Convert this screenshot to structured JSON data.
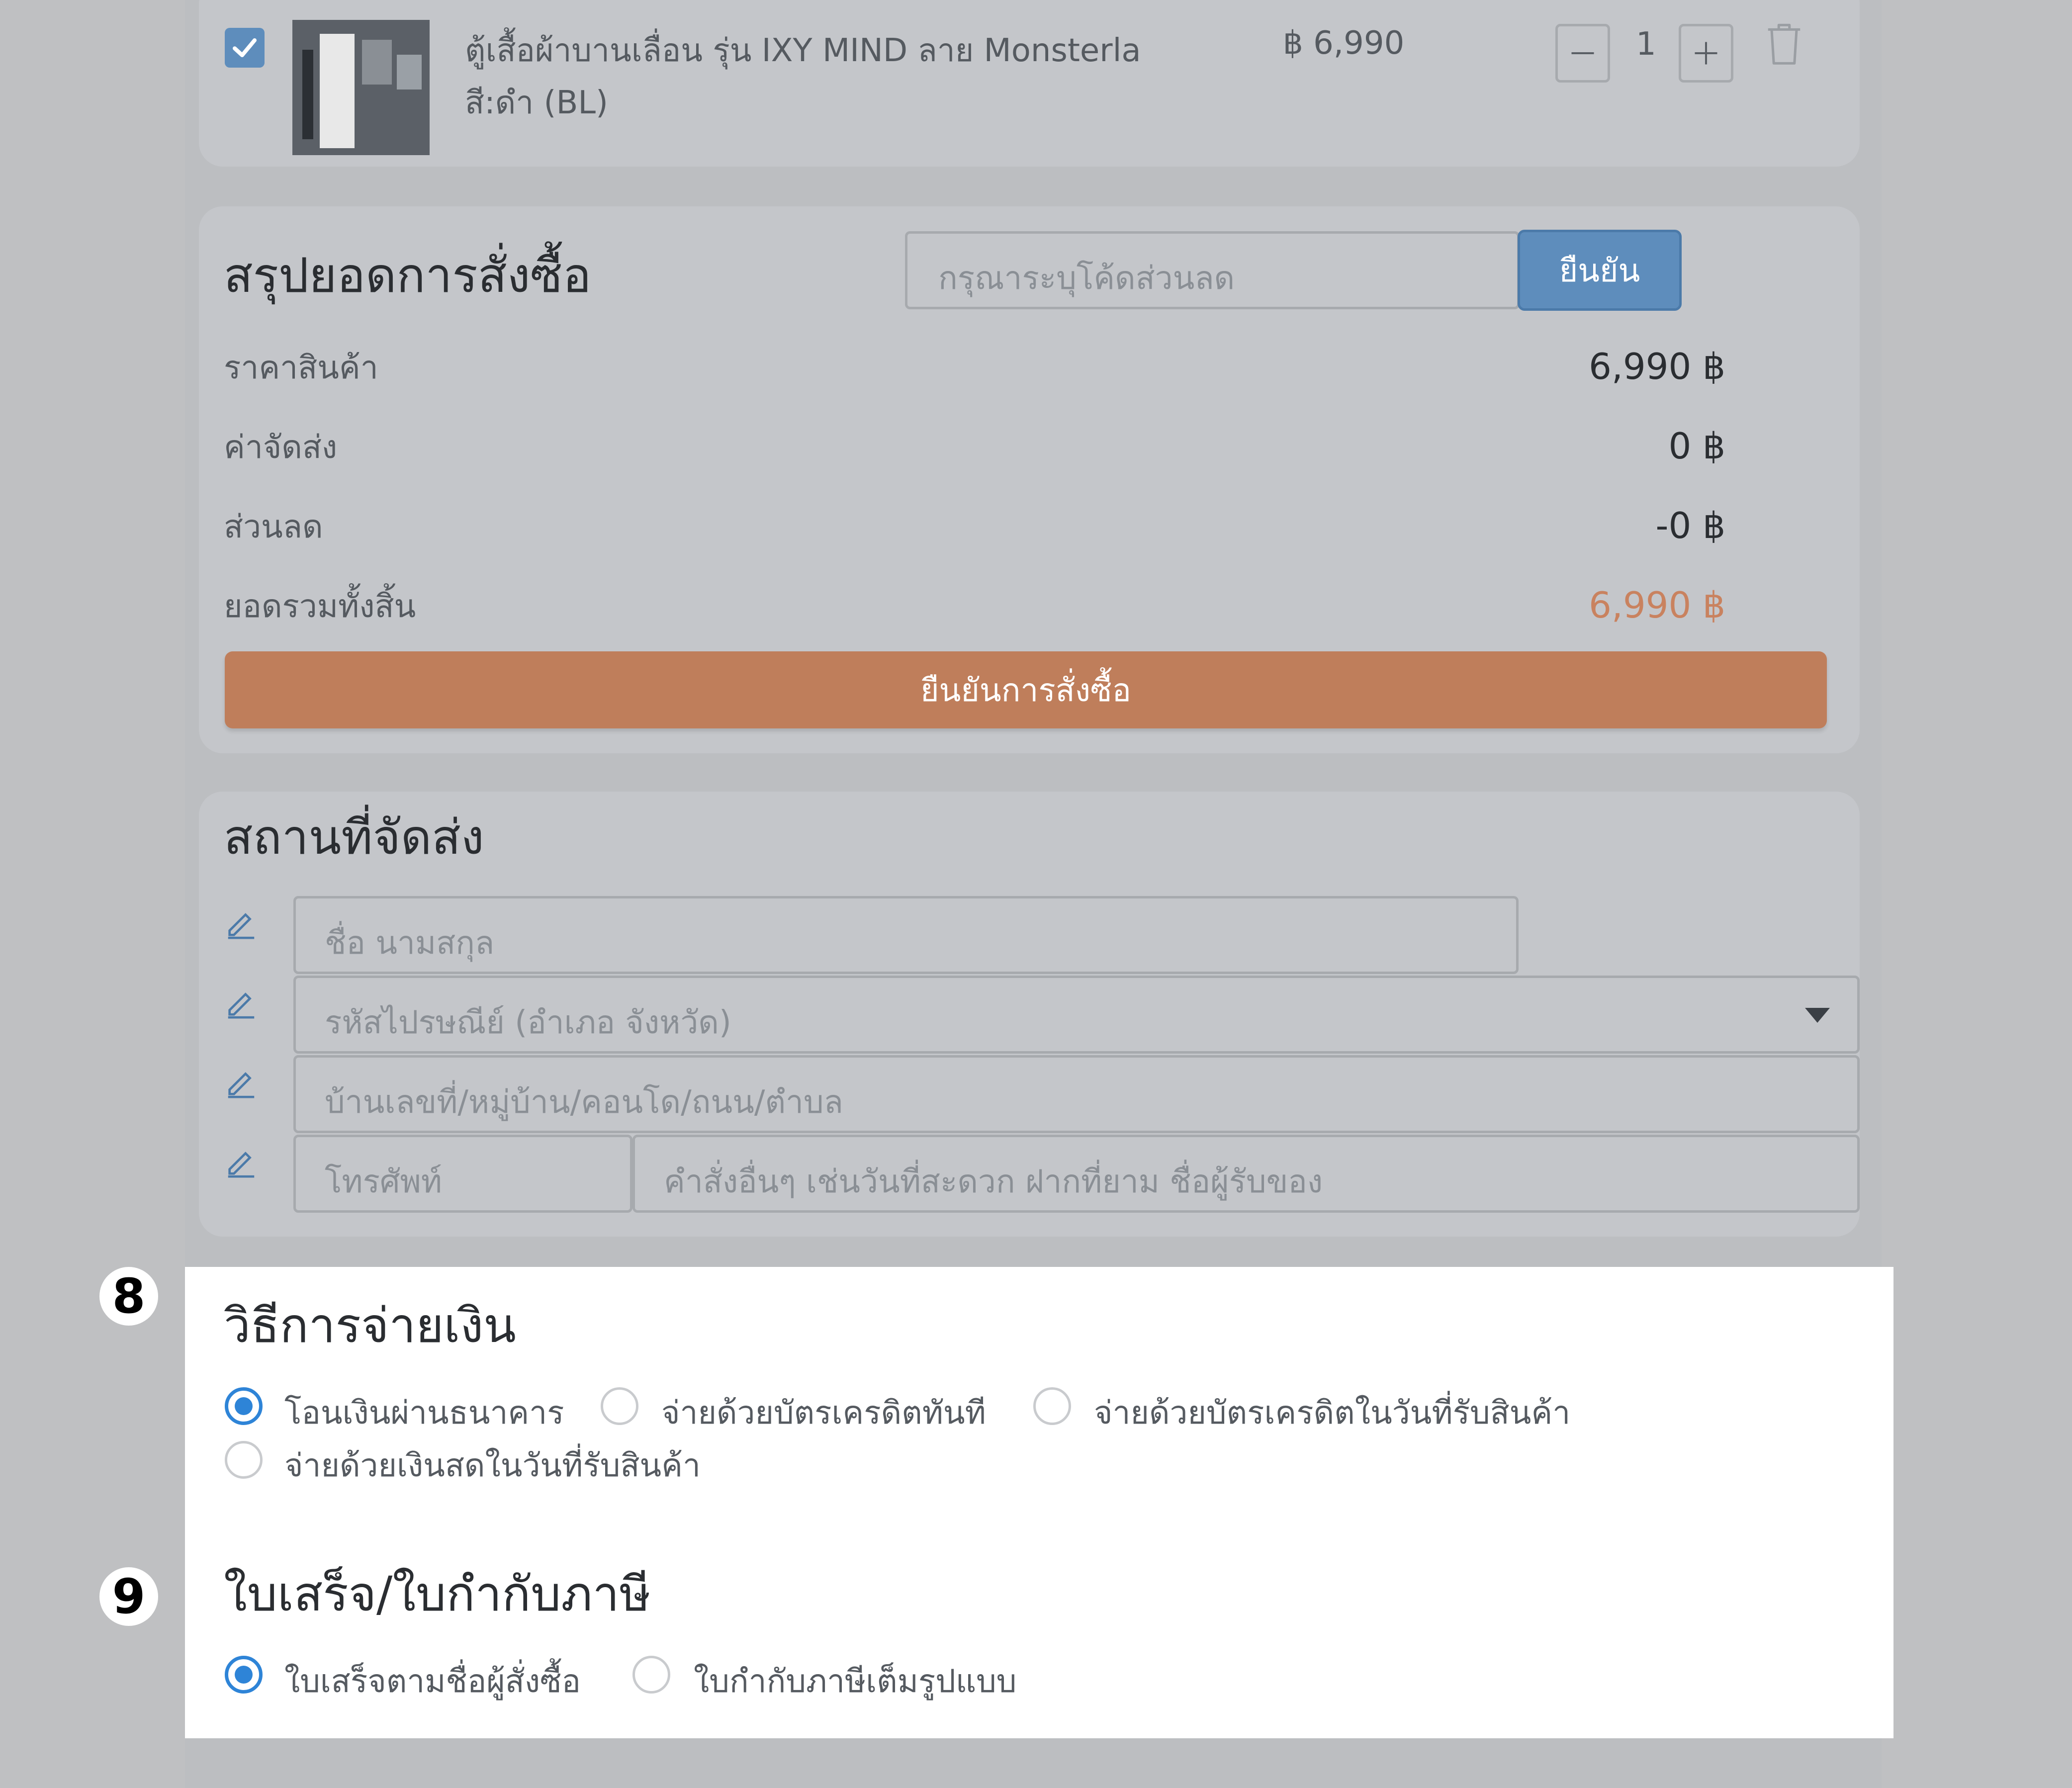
{
  "cart_item": {
    "checked": true,
    "name": "ตู้เสื้อผ้าบานเลื่อน รุ่น IXY MIND ลาย Monsterla",
    "color": "สี:ดำ (BL)",
    "price": "฿ 6,990",
    "quantity": "1",
    "minus_label": "−",
    "plus_label": "+"
  },
  "order_summary": {
    "title": "สรุปยอดการสั่งซื้อ",
    "discount_placeholder": "กรุณาระบุโค้ดส่วนลด",
    "apply_label": "ยืนยัน",
    "rows": [
      {
        "label": "ราคาสินค้า",
        "value": "6,990 ฿"
      },
      {
        "label": "ค่าจัดส่ง",
        "value": "0 ฿"
      },
      {
        "label": "ส่วนลด",
        "value": "-0 ฿"
      },
      {
        "label": "ยอดรวมทั้งสิ้น",
        "value": "6,990 ฿"
      }
    ],
    "confirm_label": "ยืนยันการสั่งซื้อ"
  },
  "shipping": {
    "title": "สถานที่จัดส่ง",
    "name_placeholder": "ชื่อ นามสกุล",
    "postcode_placeholder": "รหัสไปรษณีย์ (อำเภอ จังหวัด)",
    "address_placeholder": "บ้านเลขที่/หมู่บ้าน/คอนโด/ถนน/ตำบล",
    "phone_placeholder": "โทรศัพท์",
    "note_placeholder": "คำสั่งอื่นๆ เช่นวันที่สะดวก ฝากที่ยาม ชื่อผู้รับของ"
  },
  "payment": {
    "step_number": "8",
    "title": "วิธีการจ่ายเงิน",
    "options": [
      {
        "label": "โอนเงินผ่านธนาคาร",
        "selected": true
      },
      {
        "label": "จ่ายด้วยบัตรเครดิตทันที",
        "selected": false
      },
      {
        "label": "จ่ายด้วยบัตรเครดิตในวันที่รับสินค้า",
        "selected": false
      },
      {
        "label": "จ่ายด้วยเงินสดในวันที่รับสินค้า",
        "selected": false
      }
    ]
  },
  "receipt": {
    "step_number": "9",
    "title": "ใบเสร็จ/ใบกำกับภาษี",
    "options": [
      {
        "label": "ใบเสร็จตามชื่อผู้สั่งซื้อ",
        "selected": true
      },
      {
        "label": "ใบกำกับภาษีเต็มรูปแบบ",
        "selected": false
      }
    ]
  },
  "colors": {
    "accent_orange": "#bf7e5b",
    "accent_blue": "#5e8dbc",
    "radio_blue": "#2e84d7",
    "overlay_gray": "#bfc0c2"
  }
}
